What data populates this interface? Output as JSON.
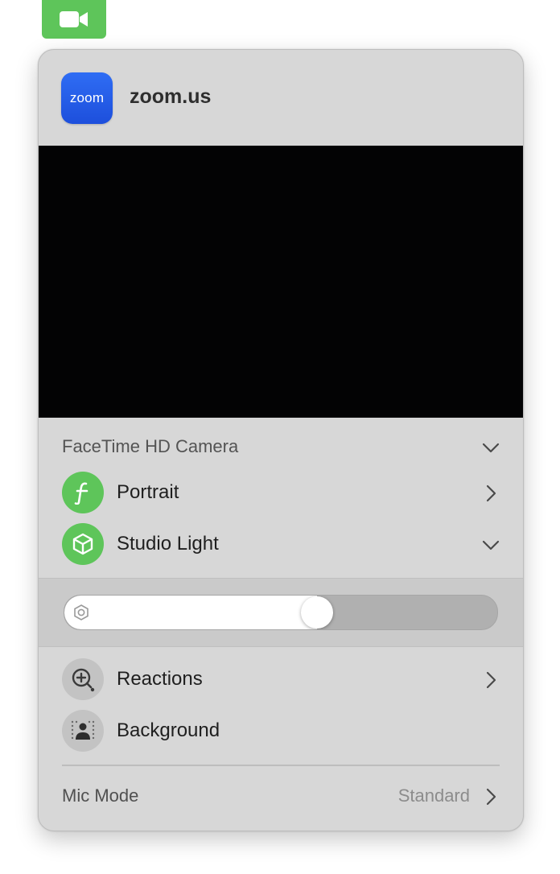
{
  "menubar": {
    "icon": "video-camera-icon",
    "color": "#5ec55a"
  },
  "app": {
    "name": "zoom.us",
    "icon_text": "zoom",
    "icon_color": "#2563eb"
  },
  "camera": {
    "label": "FaceTime HD Camera",
    "icon": "chevron-down-icon"
  },
  "effects": {
    "portrait": {
      "label": "Portrait",
      "icon": "portrait-f-icon"
    },
    "studio_light": {
      "label": "Studio Light",
      "icon": "cube-icon",
      "level": 0.59
    }
  },
  "reactions": {
    "label": "Reactions",
    "icon": "reactions-icon"
  },
  "background": {
    "label": "Background",
    "icon": "background-person-icon"
  },
  "mic_mode": {
    "label": "Mic Mode",
    "value": "Standard"
  }
}
